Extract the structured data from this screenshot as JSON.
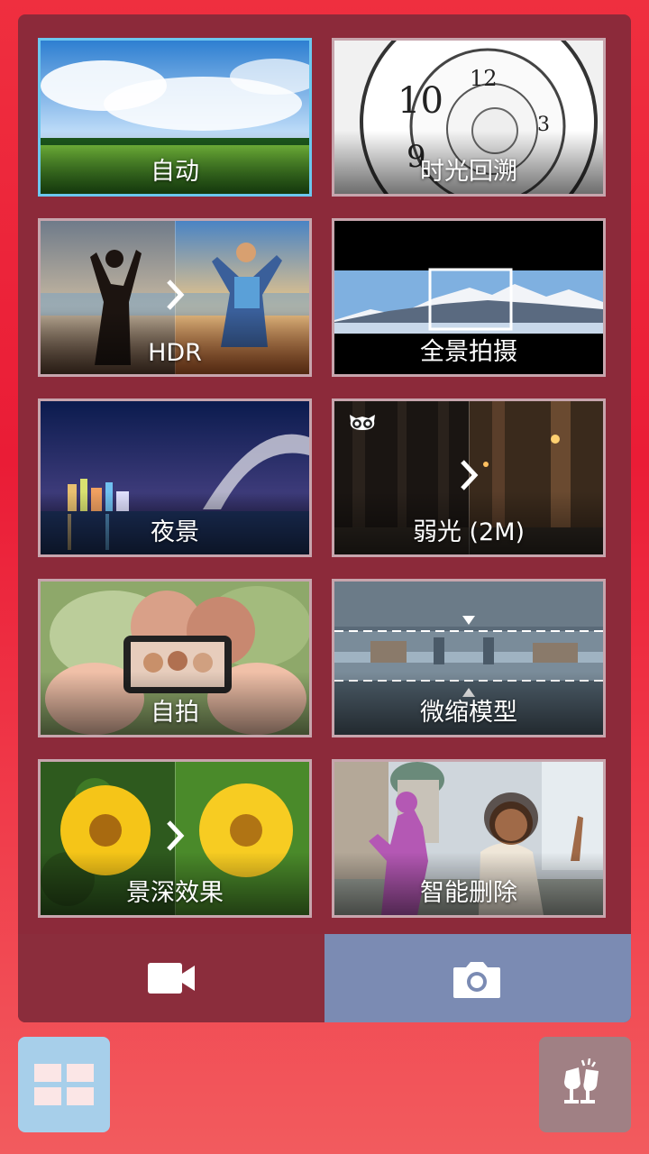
{
  "modes": [
    {
      "label": "自动",
      "selected": true
    },
    {
      "label": "时光回溯",
      "selected": false
    },
    {
      "label": "HDR",
      "selected": false
    },
    {
      "label": "全景拍摄",
      "selected": false
    },
    {
      "label": "夜景",
      "selected": false
    },
    {
      "label": "弱光 (2M)",
      "selected": false
    },
    {
      "label": "自拍",
      "selected": false
    },
    {
      "label": "微缩模型",
      "selected": false
    },
    {
      "label": "景深效果",
      "selected": false
    },
    {
      "label": "智能删除",
      "selected": false
    }
  ],
  "bottom_bar": {
    "video_icon": "video-camera-icon",
    "photo_icon": "camera-icon",
    "active": "photo"
  },
  "footer": {
    "left_icon": "grid-icon",
    "right_icon": "cheers-glasses-icon"
  },
  "colors": {
    "selected_border": "#6cc7ee",
    "panel": "#8c2a3a",
    "photo_tab": "#7b8bb3"
  }
}
